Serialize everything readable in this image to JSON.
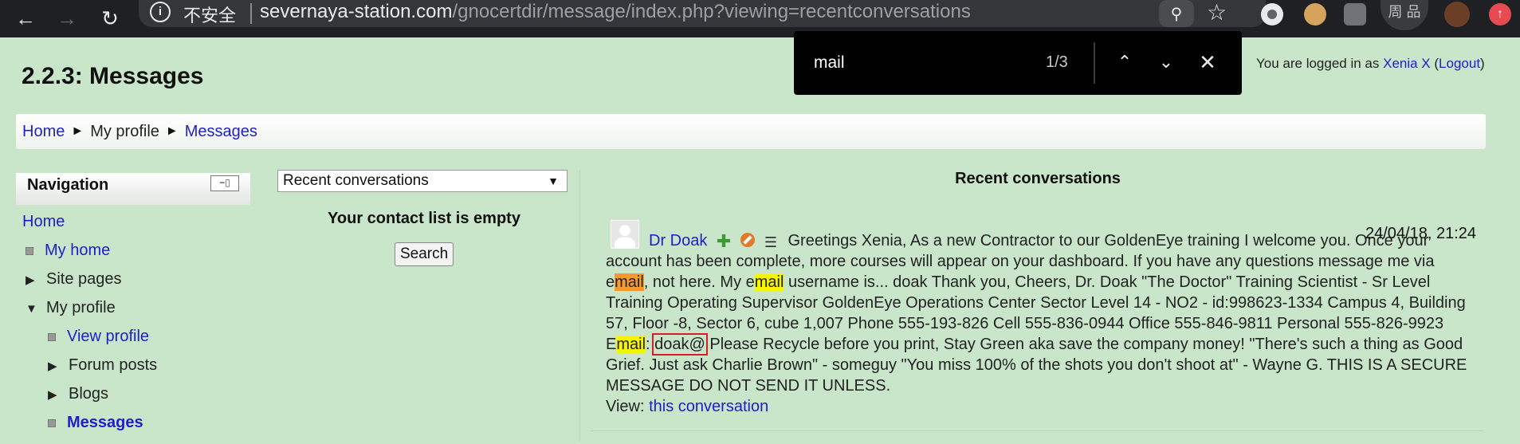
{
  "browser": {
    "not_secure_label": "不安全",
    "url_host": "severnaya-station.com",
    "url_path": "/gnocertdir/message/index.php?viewing=recentconversations",
    "avatar_text": "周 品",
    "icons": [
      "back-icon",
      "forward-icon",
      "reload-icon",
      "info-icon",
      "find-in-page-icon",
      "star-icon",
      "record-extension-icon",
      "cookie-extension-icon",
      "tiles-extension-icon",
      "profile-avatar-icon",
      "update-icon"
    ]
  },
  "find_bar": {
    "query": "mail",
    "count": "1/3"
  },
  "login": {
    "prefix": "You are logged in as ",
    "user": "Xenia X",
    "open_paren": " (",
    "logout": "Logout",
    "close_paren": ")"
  },
  "page": {
    "heading": "2.2.3: Messages"
  },
  "breadcrumb": {
    "items": [
      "Home",
      "My profile",
      "Messages"
    ],
    "separator": "►"
  },
  "navigation": {
    "title": "Navigation",
    "dock_glyph": "−▯",
    "home": "Home",
    "items": [
      {
        "label": "My home",
        "kind": "link"
      },
      {
        "label": "Site pages",
        "kind": "collapsed"
      },
      {
        "label": "My profile",
        "kind": "expanded"
      },
      {
        "label": "View profile",
        "kind": "link"
      },
      {
        "label": "Forum posts",
        "kind": "collapsed"
      },
      {
        "label": "Blogs",
        "kind": "collapsed"
      },
      {
        "label": "Messages",
        "kind": "current"
      }
    ]
  },
  "contacts": {
    "select_value": "Recent conversations",
    "empty_text": "Your contact list is empty",
    "search_label": "Search"
  },
  "recent": {
    "title": "Recent conversations",
    "message": {
      "sender": "Dr Doak",
      "date": "24/04/18, 21:24",
      "text_1": "Greetings Xenia, As a new Contractor to our GoldenEye training I welcome you. Once your account has been complete, more courses will appear on your dashboard. If you have any questions message me via e",
      "hl_1": "mail",
      "text_2": ", not here. My e",
      "hl_2": "mail",
      "text_3": " username is... doak Thank you, Cheers, Dr. Doak \"The Doctor\" Training Scientist - Sr Level Training Operating Supervisor GoldenEye Operations Center Sector Level 14 - NO2 - id:998623-1334 Campus 4, Building 57, Floor -8, Sector 6, cube 1,007 Phone 555-193-826 Cell 555-836-0944 Office 555-846-9811 Personal 555-826-9923 E",
      "hl_3": "mail",
      "text_4": ": ",
      "boxed": "doak@",
      "text_5": " Please Recycle before you print, Stay Green aka save the company money! \"There's such a thing as Good Grief. Just ask Charlie Brown\" - someguy \"You miss 100% of the shots you don't shoot at\" - Wayne G. THIS IS A SECURE MESSAGE DO NOT SEND IT UNLESS.",
      "view_prefix": "View: ",
      "view_link": "this conversation"
    }
  },
  "colors": {
    "page_bg": "#c9e6ca",
    "link": "#1e1ecc",
    "highlight": "#f5f500",
    "active_highlight": "#f59a2f",
    "selection_box": "#d91f26"
  }
}
